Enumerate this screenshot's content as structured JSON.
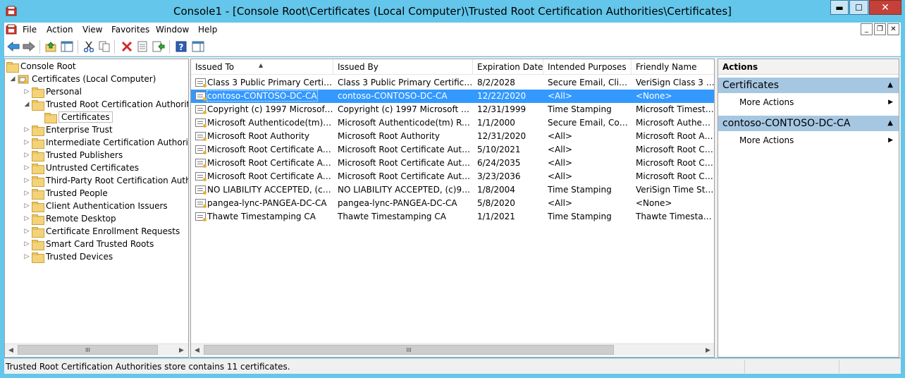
{
  "window": {
    "title": "Console1 - [Console Root\\Certificates (Local Computer)\\Trusted Root Certification Authorities\\Certificates]",
    "min_glyph": "▬",
    "max_glyph": "☐",
    "close_glyph": "✕"
  },
  "menu": {
    "items": [
      "File",
      "Action",
      "View",
      "Favorites",
      "Window",
      "Help"
    ],
    "mdi_min": "_",
    "mdi_restore": "❐",
    "mdi_close": "✕"
  },
  "toolbar": {
    "icons": [
      "back-arrow-icon",
      "forward-arrow-icon",
      "up-folder-icon",
      "show-hide-tree-icon",
      "cut-icon",
      "copy-icon",
      "delete-icon",
      "properties-icon",
      "export-list-icon",
      "help-icon",
      "show-hide-action-pane-icon"
    ]
  },
  "tree": {
    "items": [
      {
        "label": "Console Root",
        "expander": ""
      },
      {
        "label": "Certificates (Local Computer)",
        "expander": "◢"
      },
      {
        "label": "Personal",
        "expander": "▷"
      },
      {
        "label": "Trusted Root Certification Authorities",
        "expander": "◢"
      },
      {
        "label": "Certificates",
        "expander": ""
      },
      {
        "label": "Enterprise Trust",
        "expander": "▷"
      },
      {
        "label": "Intermediate Certification Authorities",
        "expander": "▷"
      },
      {
        "label": "Trusted Publishers",
        "expander": "▷"
      },
      {
        "label": "Untrusted Certificates",
        "expander": "▷"
      },
      {
        "label": "Third-Party Root Certification Authorities",
        "expander": "▷"
      },
      {
        "label": "Trusted People",
        "expander": "▷"
      },
      {
        "label": "Client Authentication Issuers",
        "expander": "▷"
      },
      {
        "label": "Remote Desktop",
        "expander": "▷"
      },
      {
        "label": "Certificate Enrollment Requests",
        "expander": "▷"
      },
      {
        "label": "Smart Card Trusted Roots",
        "expander": "▷"
      },
      {
        "label": "Trusted Devices",
        "expander": "▷"
      }
    ],
    "selected_label": "Certificates"
  },
  "list": {
    "sort_glyph": "▲",
    "columns": [
      "Issued To",
      "Issued By",
      "Expiration Date",
      "Intended Purposes",
      "Friendly Name"
    ],
    "rows": [
      [
        "Class 3 Public Primary Certificat...",
        "Class 3 Public Primary Certificatio...",
        "8/2/2028",
        "Secure Email, Client...",
        "VeriSign Class 3 Pu..."
      ],
      [
        "contoso-CONTOSO-DC-CA",
        "contoso-CONTOSO-DC-CA",
        "12/22/2020",
        "<All>",
        "<None>"
      ],
      [
        "Copyright (c) 1997 Microsoft C...",
        "Copyright (c) 1997 Microsoft Corp.",
        "12/31/1999",
        "Time Stamping",
        "Microsoft Timesta..."
      ],
      [
        "Microsoft Authenticode(tm) Ro...",
        "Microsoft Authenticode(tm) Root...",
        "1/1/2000",
        "Secure Email, Code ...",
        "Microsoft Authenti..."
      ],
      [
        "Microsoft Root Authority",
        "Microsoft Root Authority",
        "12/31/2020",
        "<All>",
        "Microsoft Root Aut..."
      ],
      [
        "Microsoft Root Certificate Auth...",
        "Microsoft Root Certificate Authori...",
        "5/10/2021",
        "<All>",
        "Microsoft Root Cert..."
      ],
      [
        "Microsoft Root Certificate Auth...",
        "Microsoft Root Certificate Authori...",
        "6/24/2035",
        "<All>",
        "Microsoft Root Cert..."
      ],
      [
        "Microsoft Root Certificate Auth...",
        "Microsoft Root Certificate Authori...",
        "3/23/2036",
        "<All>",
        "Microsoft Root Cert..."
      ],
      [
        "NO LIABILITY ACCEPTED, (c)97 ...",
        "NO LIABILITY ACCEPTED, (c)97 V...",
        "1/8/2004",
        "Time Stamping",
        "VeriSign Time Stam..."
      ],
      [
        "pangea-lync-PANGEA-DC-CA",
        "pangea-lync-PANGEA-DC-CA",
        "5/8/2020",
        "<All>",
        "<None>"
      ],
      [
        "Thawte Timestamping CA",
        "Thawte Timestamping CA",
        "1/1/2021",
        "Time Stamping",
        "Thawte Timestamp..."
      ]
    ],
    "selected_index": 1
  },
  "scroll": {
    "left_glyph": "◀",
    "right_glyph": "▶",
    "thumb_glyph": "III"
  },
  "actions": {
    "title": "Actions",
    "sections": [
      {
        "title": "Certificates",
        "items": [
          "More Actions"
        ]
      },
      {
        "title": "contoso-CONTOSO-DC-CA",
        "items": [
          "More Actions"
        ]
      }
    ],
    "collapse_glyph": "▲",
    "submenu_glyph": "▶"
  },
  "status": {
    "text": "Trusted Root Certification Authorities store contains 11 certificates."
  },
  "colors": {
    "frame": "#63c6ea",
    "selection": "#3399ff",
    "action_section": "#a6c7e2",
    "close_button": "#c4413a"
  }
}
